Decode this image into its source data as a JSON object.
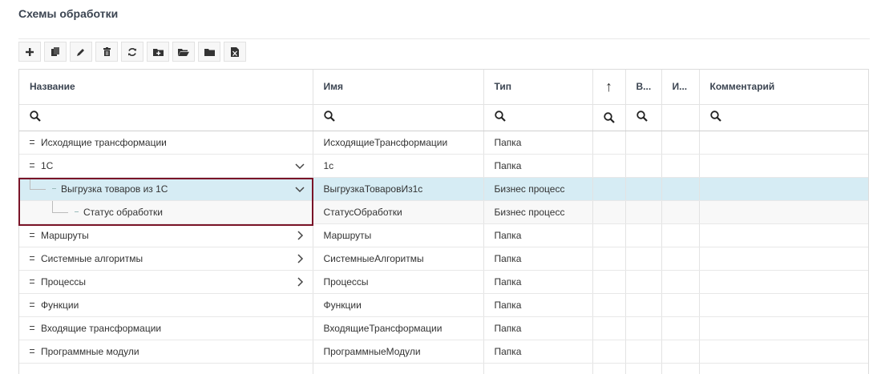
{
  "page": {
    "title": "Схемы обработки"
  },
  "toolbar": {
    "buttons": [
      {
        "icon": "plus-icon"
      },
      {
        "icon": "copy-icon"
      },
      {
        "icon": "pencil-icon"
      },
      {
        "icon": "trash-icon"
      },
      {
        "icon": "refresh-icon"
      },
      {
        "icon": "folder-add-icon"
      },
      {
        "icon": "folder-open-icon"
      },
      {
        "icon": "folder-icon"
      },
      {
        "icon": "excel-icon"
      }
    ]
  },
  "grid": {
    "columns": {
      "name": "Название",
      "ident": "Имя",
      "type": "Тип",
      "sort_arrow": "↑",
      "col_v": "В...",
      "col_i": "И...",
      "comment": "Комментарий"
    },
    "rows": [
      {
        "name": "Исходящие трансформации",
        "ident": "ИсходящиеТрансформации",
        "type": "Папка"
      },
      {
        "name": "1С",
        "ident": "1с",
        "type": "Папка"
      },
      {
        "name": "Выгрузка товаров из 1С",
        "ident": "ВыгрузкаТоваровИз1с",
        "type": "Бизнес процесс"
      },
      {
        "name": "Статус обработки",
        "ident": "СтатусОбработки",
        "type": "Бизнес процесс"
      },
      {
        "name": "Маршруты",
        "ident": "Маршруты",
        "type": "Папка"
      },
      {
        "name": "Системные алгоритмы",
        "ident": "СистемныеАлгоритмы",
        "type": "Папка"
      },
      {
        "name": "Процессы",
        "ident": "Процессы",
        "type": "Папка"
      },
      {
        "name": "Функции",
        "ident": "Функции",
        "type": "Папка"
      },
      {
        "name": "Входящие трансформации",
        "ident": "ВходящиеТрансформации",
        "type": "Папка"
      },
      {
        "name": "Программные модули",
        "ident": "ПрограммныеМодули",
        "type": "Папка"
      }
    ]
  }
}
